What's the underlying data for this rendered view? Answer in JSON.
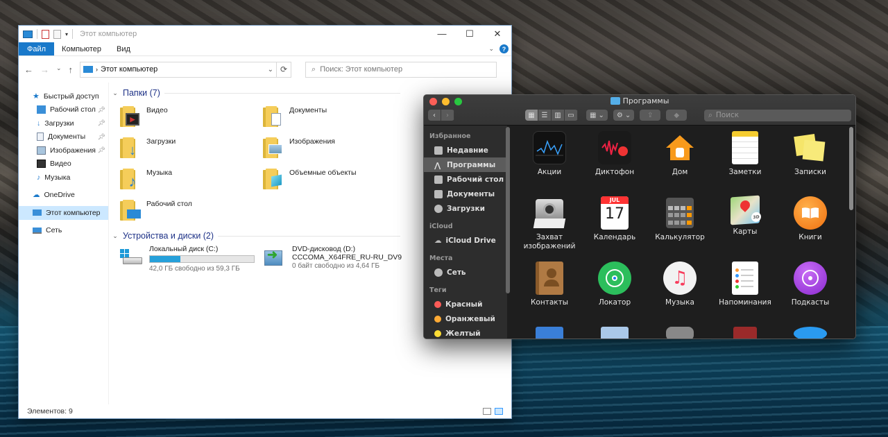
{
  "explorer": {
    "title": "Этот компьютер",
    "ribbon_tabs": [
      "Файл",
      "Компьютер",
      "Вид"
    ],
    "address": "Этот компьютер",
    "search_placeholder": "Поиск: Этот компьютер",
    "sidebar": {
      "quick_access": "Быстрый доступ",
      "quick_items": [
        "Рабочий стол",
        "Загрузки",
        "Документы",
        "Изображения",
        "Видео",
        "Музыка"
      ],
      "onedrive": "OneDrive",
      "this_pc": "Этот компьютер",
      "network": "Сеть"
    },
    "folders_group": "Папки (7)",
    "folders": [
      "Видео",
      "Документы",
      "Загрузки",
      "Изображения",
      "Музыка",
      "Объемные объекты",
      "Рабочий стол"
    ],
    "devices_group": "Устройства и диски (2)",
    "drives": [
      {
        "name": "Локальный диск (C:)",
        "free": "42,0 ГБ свободно из 59,3 ГБ",
        "used_fraction": 0.29
      },
      {
        "name": "DVD-дисковод (D:)",
        "label": "CCCOMA_X64FRE_RU-RU_DV9",
        "free": "0 байт свободно из 4,64 ГБ"
      }
    ],
    "status": "Элементов: 9",
    "accent": "#1979ca"
  },
  "finder": {
    "title": "Программы",
    "search_placeholder": "Поиск",
    "sidebar": {
      "favorites": "Избранное",
      "fav_items": [
        "Недавние",
        "Программы",
        "Рабочий стол",
        "Документы",
        "Загрузки"
      ],
      "icloud": "iCloud",
      "icloud_items": [
        "iCloud Drive"
      ],
      "places": "Места",
      "place_items": [
        "Сеть"
      ],
      "tags": "Теги",
      "tag_items": [
        {
          "label": "Красный",
          "color": "#fc5b57"
        },
        {
          "label": "Оранжевый",
          "color": "#fdaa35"
        },
        {
          "label": "Желтый",
          "color": "#fedd35"
        }
      ]
    },
    "apps": [
      {
        "label": "Акции",
        "icon": "stocks-icon"
      },
      {
        "label": "Диктофон",
        "icon": "voice-memos-icon"
      },
      {
        "label": "Дом",
        "icon": "home-icon"
      },
      {
        "label": "Заметки",
        "icon": "notes-icon"
      },
      {
        "label": "Записки",
        "icon": "stickies-icon"
      },
      {
        "label": "Захват изображений",
        "icon": "image-capture-icon"
      },
      {
        "label": "Календарь",
        "icon": "calendar-icon"
      },
      {
        "label": "Калькулятор",
        "icon": "calculator-icon"
      },
      {
        "label": "Карты",
        "icon": "maps-icon"
      },
      {
        "label": "Книги",
        "icon": "books-icon"
      },
      {
        "label": "Контакты",
        "icon": "contacts-icon"
      },
      {
        "label": "Локатор",
        "icon": "find-my-icon"
      },
      {
        "label": "Музыка",
        "icon": "music-icon"
      },
      {
        "label": "Напоминания",
        "icon": "reminders-icon"
      },
      {
        "label": "Подкасты",
        "icon": "podcasts-icon"
      }
    ],
    "calendar_month": "JUL",
    "calendar_day": "17"
  }
}
